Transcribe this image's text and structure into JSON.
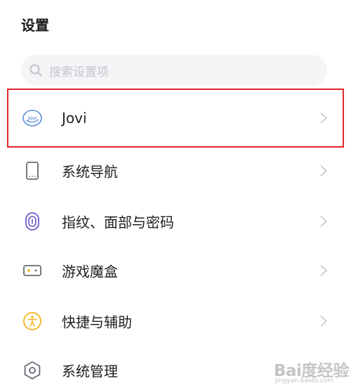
{
  "header": {
    "title": "设置"
  },
  "search": {
    "placeholder": "搜索设置项"
  },
  "items": [
    {
      "label": "Jovi",
      "icon": "jovi-icon",
      "highlighted": true
    },
    {
      "label": "系统导航",
      "icon": "phone-navigation-icon"
    },
    {
      "label": "指纹、面部与密码",
      "icon": "fingerprint-icon"
    },
    {
      "label": "游戏魔盒",
      "icon": "gamepad-icon"
    },
    {
      "label": "快捷与辅助",
      "icon": "accessibility-icon"
    },
    {
      "label": "系统管理",
      "icon": "hexagon-settings-icon"
    }
  ],
  "colors": {
    "highlight_border": "#e0262d",
    "icon_blue": "#5a8fd8",
    "icon_purple": "#6a5acd",
    "icon_yellow": "#f2b31c",
    "icon_gray": "#666a73"
  },
  "watermark": {
    "text": "Bai度经验",
    "sub": "jingyan.baidu.com"
  }
}
